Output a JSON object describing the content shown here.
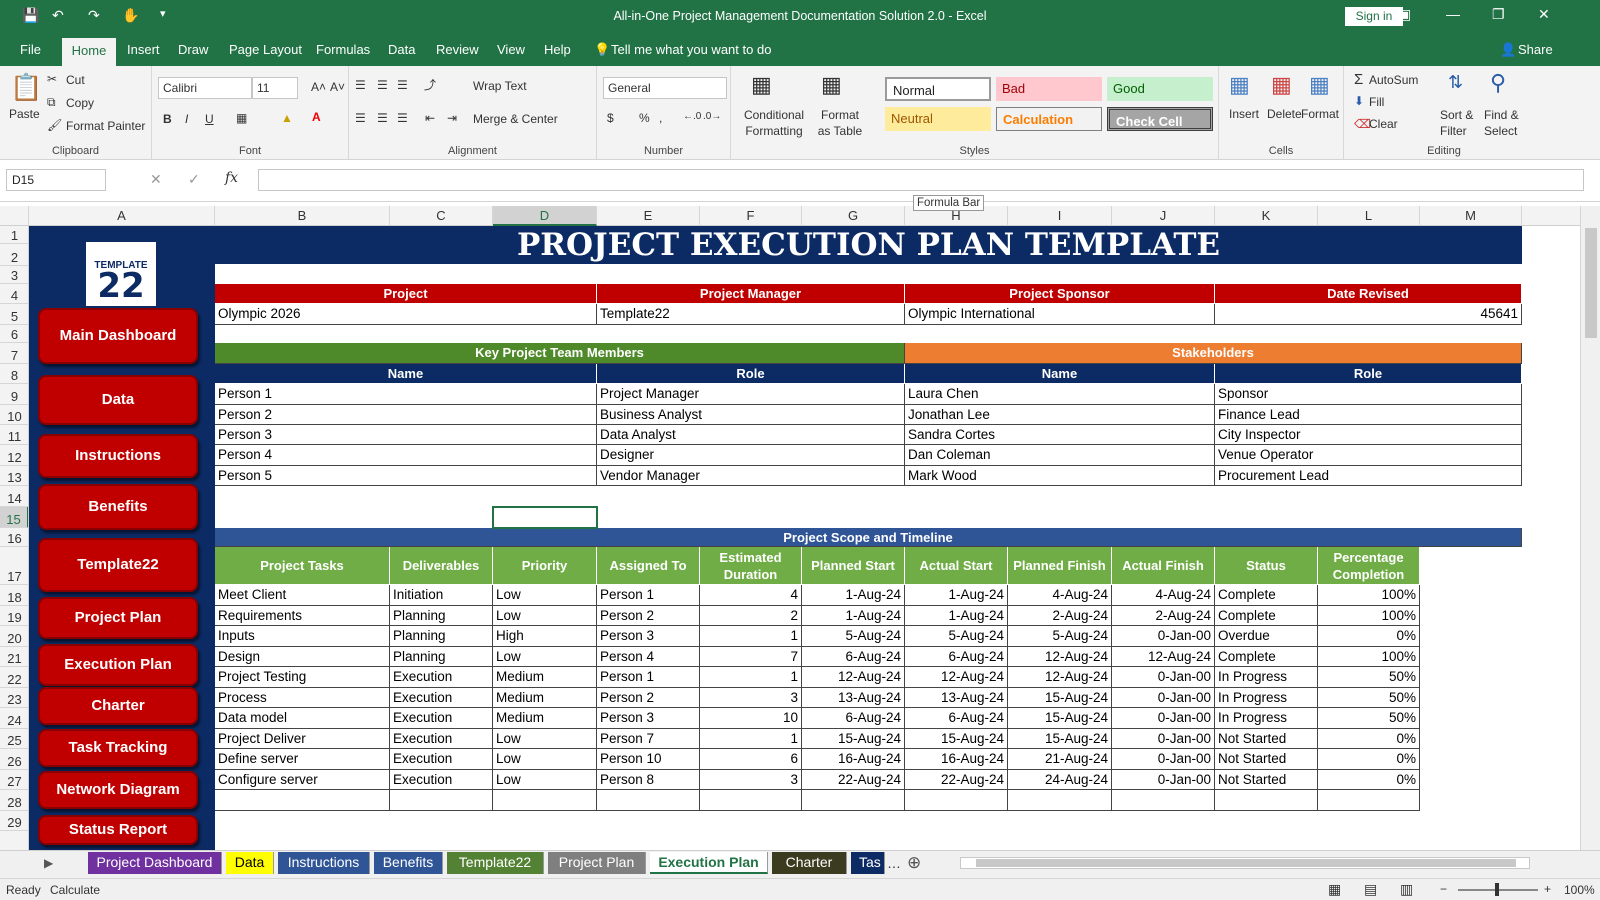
{
  "app": {
    "title": "All-in-One Project Management Documentation Solution 2.0  -  Excel",
    "sign_in": "Sign in",
    "share": "Share"
  },
  "ribbon_tabs": [
    "File",
    "Home",
    "Insert",
    "Draw",
    "Page Layout",
    "Formulas",
    "Data",
    "Review",
    "View",
    "Help"
  ],
  "tell_me": "Tell me what you want to do",
  "clipboard": {
    "paste": "Paste",
    "cut": "Cut",
    "copy": "Copy",
    "format_painter": "Format Painter",
    "group": "Clipboard"
  },
  "font": {
    "name": "Calibri",
    "size": "11",
    "group": "Font",
    "bold": "B",
    "italic": "I",
    "underline": "U"
  },
  "alignment": {
    "wrap": "Wrap Text",
    "merge": "Merge & Center",
    "group": "Alignment"
  },
  "number": {
    "format": "General",
    "group": "Number",
    "currency": "$",
    "percent": "%",
    "comma": ","
  },
  "styles": {
    "cond": "Conditional Formatting",
    "format_table": "Format as Table",
    "normal": "Normal",
    "bad": "Bad",
    "good": "Good",
    "neutral": "Neutral",
    "calculation": "Calculation",
    "check": "Check Cell",
    "group": "Styles"
  },
  "cells": {
    "insert": "Insert",
    "delete": "Delete",
    "format": "Format",
    "group": "Cells"
  },
  "editing": {
    "autosum": "AutoSum",
    "fill": "Fill",
    "clear": "Clear",
    "sort": "Sort & Filter",
    "find": "Find & Select",
    "group": "Editing"
  },
  "name_box": "D15",
  "tooltip": "Formula Bar",
  "columns": [
    "A",
    "B",
    "C",
    "D",
    "E",
    "F",
    "G",
    "H",
    "I",
    "J",
    "K",
    "L",
    "M"
  ],
  "rows": [
    "1",
    "2",
    "3",
    "4",
    "5",
    "6",
    "7",
    "8",
    "9",
    "10",
    "11",
    "12",
    "13",
    "14",
    "15",
    "16",
    "17",
    "18",
    "19",
    "20",
    "21",
    "22",
    "23",
    "24",
    "25",
    "26",
    "27",
    "28",
    "29"
  ],
  "logo_text": "TEMPLATE",
  "logo_num": "22",
  "nav": [
    "Main Dashboard",
    "Data",
    "Instructions",
    "Benefits",
    "Template22",
    "Project Plan",
    "Execution Plan",
    "Charter",
    "Task Tracking",
    "Network Diagram",
    "Status Report"
  ],
  "sheet_title": "PROJECT EXECUTION PLAN TEMPLATE",
  "info_headers": [
    "Project",
    "Project Manager",
    "Project Sponsor",
    "Date Revised"
  ],
  "info_values": [
    "Olympic 2026",
    "Template22",
    "Olympic International",
    "45641"
  ],
  "team_header": "Key Project Team Members",
  "stake_header": "Stakeholders",
  "sub_headers": [
    "Name",
    "Role",
    "Name",
    "Role"
  ],
  "team": [
    [
      "Person 1",
      "Project Manager"
    ],
    [
      "Person 2",
      "Business Analyst"
    ],
    [
      "Person 3",
      "Data Analyst"
    ],
    [
      "Person 4",
      "Designer"
    ],
    [
      "Person 5",
      "Vendor Manager"
    ]
  ],
  "stakeholders": [
    [
      "Laura Chen",
      "Sponsor"
    ],
    [
      "Jonathan Lee",
      "Finance Lead"
    ],
    [
      "Sandra Cortes",
      "City Inspector"
    ],
    [
      "Dan Coleman",
      "Venue Operator"
    ],
    [
      "Mark Wood",
      "Procurement Lead"
    ]
  ],
  "scope_header": "Project Scope and Timeline",
  "task_headers": [
    "Project Tasks",
    "Deliverables",
    "Priority",
    "Assigned To",
    "Estimated Duration",
    "Planned Start",
    "Actual Start",
    "Planned Finish",
    "Actual Finish",
    "Status",
    "Percentage Completion"
  ],
  "tasks": [
    [
      "Meet Client",
      "Initiation",
      "Low",
      "Person 1",
      "4",
      "1-Aug-24",
      "1-Aug-24",
      "4-Aug-24",
      "4-Aug-24",
      "Complete",
      "100%"
    ],
    [
      "Requirements",
      "Planning",
      "Low",
      "Person 2",
      "2",
      "1-Aug-24",
      "1-Aug-24",
      "2-Aug-24",
      "2-Aug-24",
      "Complete",
      "100%"
    ],
    [
      "Inputs",
      "Planning",
      "High",
      "Person 3",
      "1",
      "5-Aug-24",
      "5-Aug-24",
      "5-Aug-24",
      "0-Jan-00",
      "Overdue",
      "0%"
    ],
    [
      "Design",
      "Planning",
      "Low",
      "Person 4",
      "7",
      "6-Aug-24",
      "6-Aug-24",
      "12-Aug-24",
      "12-Aug-24",
      "Complete",
      "100%"
    ],
    [
      "Project Testing",
      "Execution",
      "Medium",
      "Person 1",
      "1",
      "12-Aug-24",
      "12-Aug-24",
      "12-Aug-24",
      "0-Jan-00",
      "In Progress",
      "50%"
    ],
    [
      "Process",
      "Execution",
      "Medium",
      "Person 2",
      "3",
      "13-Aug-24",
      "13-Aug-24",
      "15-Aug-24",
      "0-Jan-00",
      "In Progress",
      "50%"
    ],
    [
      "Data model",
      "Execution",
      "Medium",
      "Person 3",
      "10",
      "6-Aug-24",
      "6-Aug-24",
      "15-Aug-24",
      "0-Jan-00",
      "In Progress",
      "50%"
    ],
    [
      "Project Deliver",
      "Execution",
      "Low",
      "Person 7",
      "1",
      "15-Aug-24",
      "15-Aug-24",
      "15-Aug-24",
      "0-Jan-00",
      "Not Started",
      "0%"
    ],
    [
      "Define server",
      "Execution",
      "Low",
      "Person 10",
      "6",
      "16-Aug-24",
      "16-Aug-24",
      "21-Aug-24",
      "0-Jan-00",
      "Not Started",
      "0%"
    ],
    [
      "Configure server",
      "Execution",
      "Low",
      "Person 8",
      "3",
      "22-Aug-24",
      "22-Aug-24",
      "24-Aug-24",
      "0-Jan-00",
      "Not Started",
      "0%"
    ]
  ],
  "sheet_tabs": [
    "Project Dashboard",
    "Data",
    "Instructions",
    "Benefits",
    "Template22",
    "Project Plan",
    "Execution Plan",
    "Charter",
    "Tas"
  ],
  "status": {
    "ready": "Ready",
    "calc": "Calculate",
    "zoom": "100%"
  }
}
